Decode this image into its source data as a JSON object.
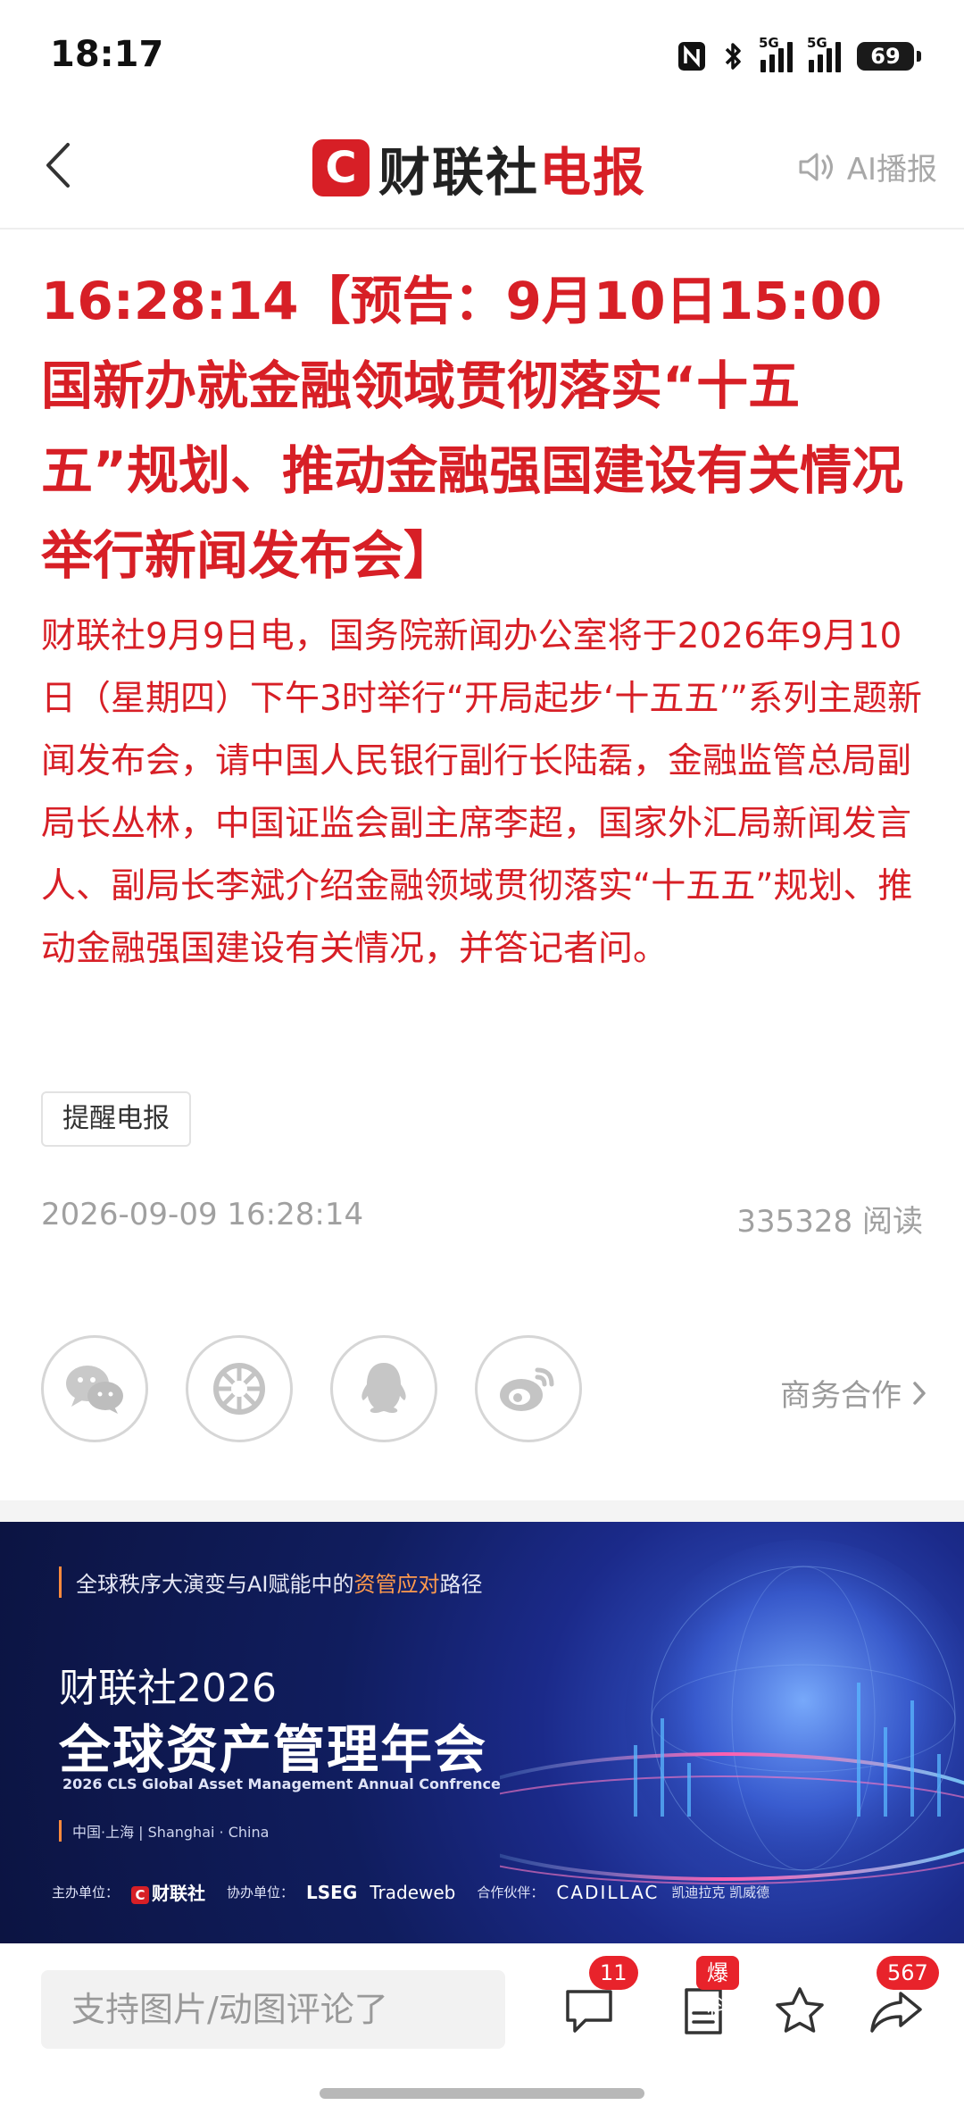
{
  "status_bar": {
    "time": "18:17",
    "battery": "69",
    "net1": "5G",
    "net2": "5G"
  },
  "header": {
    "logo_mark": "C",
    "logo_black": "财联社",
    "logo_red": "电报",
    "ai_broadcast_label": "AI播报"
  },
  "article": {
    "headline": "16:28:14【预告：9月10日15:00国新办就金融领域贯彻落实“十五五”规划、推动金融强国建设有关情况举行新闻发布会】",
    "body": "财联社9月9日电，国务院新闻办公室将于2026年9月10日（星期四）下午3时举行“开局起步‘十五五’”系列主题新闻发布会，请中国人民银行副行长陆磊，金融监管总局副局长丛林，中国证监会副主席李超，国家外汇局新闻发言人、副局长李斌介绍金融领域贯彻落实“十五五”规划、推动金融强国建设有关情况，并答记者问。",
    "remind_label": "提醒电报",
    "datetime": "2026-09-09 16:28:14",
    "reads": "335328 阅读"
  },
  "share": {
    "icons": [
      "wechat-icon",
      "moments-icon",
      "qq-icon",
      "weibo-icon"
    ],
    "business_label": "商务合作"
  },
  "banner": {
    "tagline_a": "全球秩序大演变与AI赋能中的",
    "tagline_b": "资管应对",
    "tagline_c": "路径",
    "title1": "财联社2026",
    "title2": "全球资产管理年会",
    "english": "2026 CLS Global Asset Management Annual Confrence",
    "location": "中国·上海 | Shanghai · China",
    "host_label": "主办单位：",
    "host_name": "财联社",
    "co_label": "协办单位：",
    "co1": "LSEG",
    "co2": "Tradeweb",
    "partner_label": "合作伙伴：",
    "partner1": "CADILLAC",
    "partner2": "凯迪拉克 凯威德"
  },
  "bottom_bar": {
    "comment_placeholder": "支持图片/动图评论了",
    "comment_count": "11",
    "report_label": "爆料",
    "share_count": "567"
  },
  "colors": {
    "accent": "#d71f26",
    "badge": "#e8232b"
  }
}
